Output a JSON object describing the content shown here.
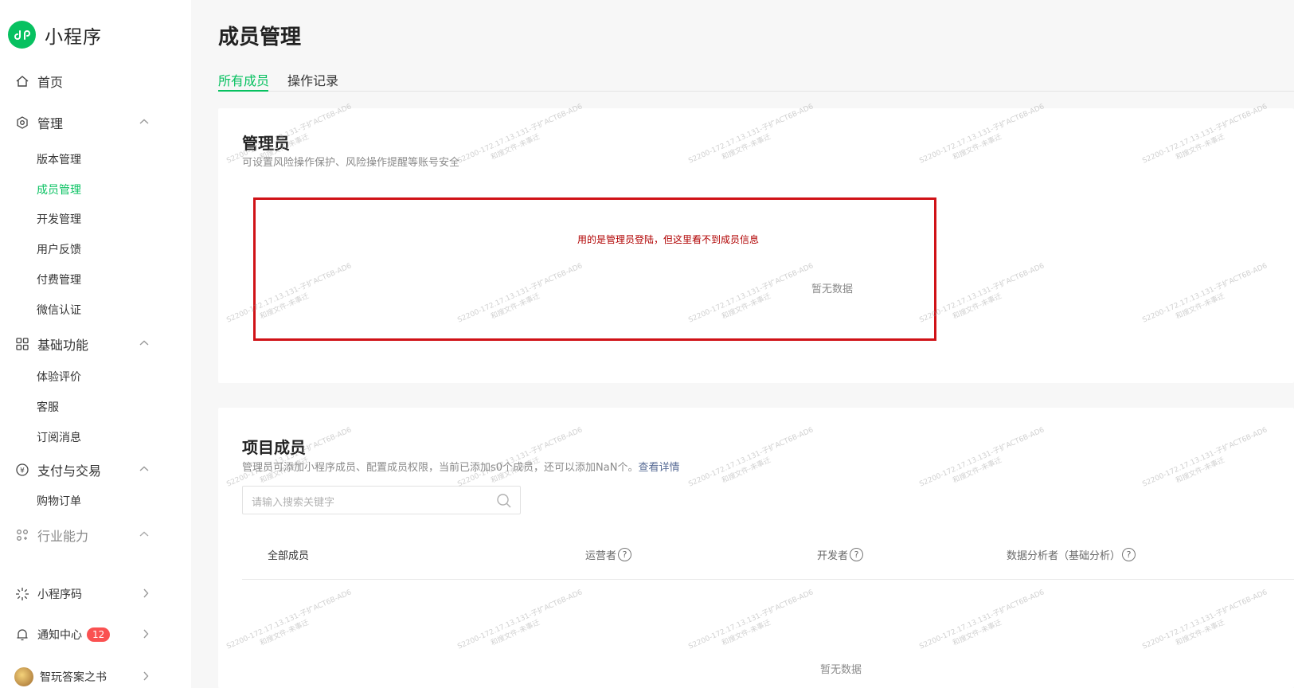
{
  "app": {
    "logo_text": "小程序"
  },
  "sidebar": {
    "home": "首页",
    "manage": {
      "label": "管理",
      "items": [
        "版本管理",
        "成员管理",
        "开发管理",
        "用户反馈",
        "付费管理",
        "微信认证"
      ]
    },
    "basic": {
      "label": "基础功能",
      "items": [
        "体验评价",
        "客服",
        "订阅消息"
      ]
    },
    "payment": {
      "label": "支付与交易",
      "items": [
        "购物订单"
      ]
    },
    "industry": {
      "label": "行业能力"
    },
    "qrcode": {
      "label": "小程序码"
    },
    "notify": {
      "label": "通知中心",
      "badge": "12"
    },
    "account": {
      "label": "智玩答案之书"
    }
  },
  "main": {
    "title": "成员管理",
    "tabs": [
      "所有成员",
      "操作记录"
    ],
    "admin_card": {
      "title": "管理员",
      "desc": "可设置风险操作保护、风险操作提醒等账号安全",
      "annotation": "用的是管理员登陆，但这里看不到成员信息",
      "empty": "暂无数据"
    },
    "project_card": {
      "title": "项目成员",
      "desc": "管理员可添加小程序成员、配置成员权限，当前已添加s0个成员，还可以添加NaN个。",
      "desc_link": "查看详情",
      "search_placeholder": "请输入搜索关键字",
      "columns": [
        "全部成员",
        "运营者",
        "开发者",
        "数据分析者（基础分析）"
      ],
      "empty": "暂无数据"
    }
  },
  "colors": {
    "accent": "#07c160",
    "annotation": "#d01217",
    "badge": "#fa5151"
  },
  "icons": [
    "logo-icon",
    "home-icon",
    "manage-icon",
    "grid-icon",
    "payment-icon",
    "industry-icon",
    "qrcode-icon",
    "bell-icon",
    "chevron-up-icon",
    "chevron-right-icon",
    "search-icon",
    "help-icon"
  ],
  "watermark": {
    "line1": "S2200-172.17.13.131-子扩ACT6B-AD6",
    "line2": "和搜文件-未事迁"
  }
}
